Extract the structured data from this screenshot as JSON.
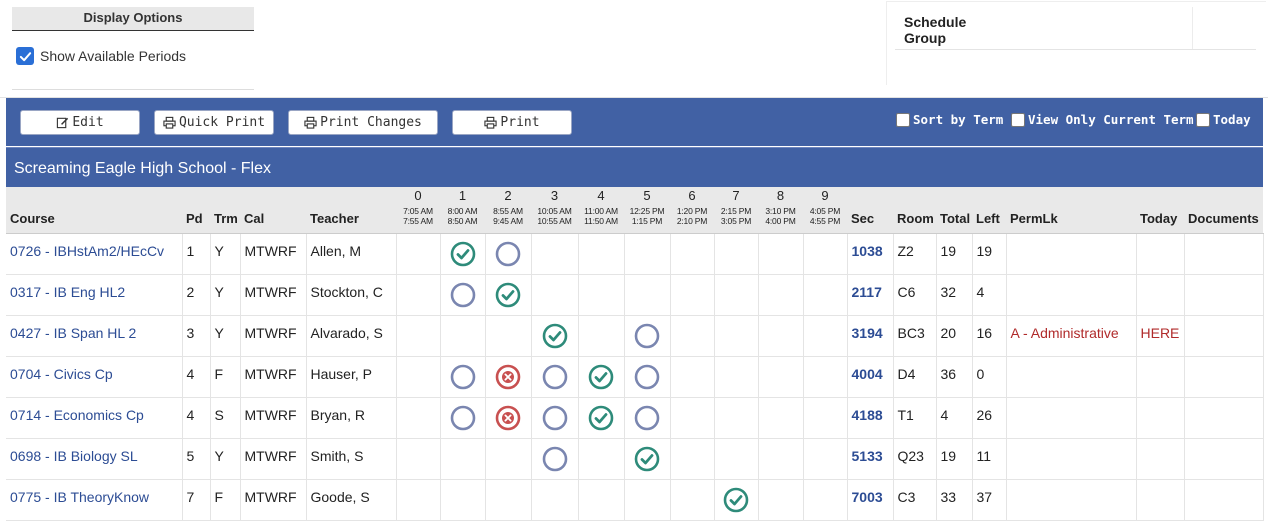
{
  "display_options": {
    "header": "Display Options",
    "show_available_periods": "Show Available Periods"
  },
  "schedule_group": {
    "label": "Schedule Group"
  },
  "toolbar": {
    "edit": "Edit",
    "quick_print": "Quick Print",
    "print_changes": "Print Changes",
    "print": "Print",
    "sort_by_term": "Sort by Term",
    "view_only_current_term": "View Only Current Term",
    "today": "Today"
  },
  "school_title": "Screaming Eagle High School - Flex",
  "columns": {
    "course": "Course",
    "pd": "Pd",
    "trm": "Trm",
    "cal": "Cal",
    "teacher": "Teacher",
    "sec": "Sec",
    "room": "Room",
    "total": "Total",
    "left": "Left",
    "permlk": "PermLk",
    "today": "Today",
    "documents": "Documents"
  },
  "periods": [
    {
      "num": "0",
      "start": "7:05 AM",
      "end": "7:55 AM"
    },
    {
      "num": "1",
      "start": "8:00 AM",
      "end": "8:50 AM"
    },
    {
      "num": "2",
      "start": "8:55 AM",
      "end": "9:45 AM"
    },
    {
      "num": "3",
      "start": "10:05 AM",
      "end": "10:55 AM"
    },
    {
      "num": "4",
      "start": "11:00 AM",
      "end": "11:50 AM"
    },
    {
      "num": "5",
      "start": "12:25 PM",
      "end": "1:15 PM"
    },
    {
      "num": "6",
      "start": "1:20 PM",
      "end": "2:10 PM"
    },
    {
      "num": "7",
      "start": "2:15 PM",
      "end": "3:05 PM"
    },
    {
      "num": "8",
      "start": "3:10 PM",
      "end": "4:00 PM"
    },
    {
      "num": "9",
      "start": "4:05 PM",
      "end": "4:55 PM"
    }
  ],
  "rows": [
    {
      "course": "0726 - IBHstAm2/HEcCv",
      "pd": "1",
      "trm": "Y",
      "cal": "MTWRF",
      "teacher": "Allen, M",
      "slots": [
        "",
        "check",
        "open",
        "",
        "",
        "",
        "",
        "",
        "",
        ""
      ],
      "sec": "1038",
      "room": "Z2",
      "total": "19",
      "left": "19",
      "permlk": "",
      "today": "",
      "documents": ""
    },
    {
      "course": "0317 - IB Eng HL2",
      "pd": "2",
      "trm": "Y",
      "cal": "MTWRF",
      "teacher": "Stockton, C",
      "slots": [
        "",
        "open",
        "check",
        "",
        "",
        "",
        "",
        "",
        "",
        ""
      ],
      "sec": "2117",
      "room": "C6",
      "total": "32",
      "left": "4",
      "permlk": "",
      "today": "",
      "documents": ""
    },
    {
      "course": "0427 - IB Span HL 2",
      "pd": "3",
      "trm": "Y",
      "cal": "MTWRF",
      "teacher": "Alvarado, S",
      "slots": [
        "",
        "",
        "",
        "check",
        "",
        "open",
        "",
        "",
        "",
        ""
      ],
      "sec": "3194",
      "room": "BC3",
      "total": "20",
      "left": "16",
      "permlk": "A - Administrative",
      "today": "HERE",
      "documents": ""
    },
    {
      "course": "0704 - Civics Cp",
      "pd": "4",
      "trm": "F",
      "cal": "MTWRF",
      "teacher": "Hauser, P",
      "slots": [
        "",
        "open",
        "x",
        "open",
        "check",
        "open",
        "",
        "",
        "",
        ""
      ],
      "sec": "4004",
      "room": "D4",
      "total": "36",
      "left": "0",
      "permlk": "",
      "today": "",
      "documents": ""
    },
    {
      "course": "0714 - Economics Cp",
      "pd": "4",
      "trm": "S",
      "cal": "MTWRF",
      "teacher": "Bryan, R",
      "slots": [
        "",
        "open",
        "x",
        "open",
        "check",
        "open",
        "",
        "",
        "",
        ""
      ],
      "sec": "4188",
      "room": "T1",
      "total": "4",
      "left": "26",
      "permlk": "",
      "today": "",
      "documents": ""
    },
    {
      "course": "0698 - IB Biology SL",
      "pd": "5",
      "trm": "Y",
      "cal": "MTWRF",
      "teacher": "Smith, S",
      "slots": [
        "",
        "",
        "",
        "open",
        "",
        "check",
        "",
        "",
        "",
        ""
      ],
      "sec": "5133",
      "room": "Q23",
      "total": "19",
      "left": "11",
      "permlk": "",
      "today": "",
      "documents": ""
    },
    {
      "course": "0775 - IB TheoryKnow",
      "pd": "7",
      "trm": "F",
      "cal": "MTWRF",
      "teacher": "Goode, S",
      "slots": [
        "",
        "",
        "",
        "",
        "",
        "",
        "",
        "check",
        "",
        ""
      ],
      "sec": "7003",
      "room": "C3",
      "total": "33",
      "left": "37",
      "permlk": "",
      "today": "",
      "documents": ""
    }
  ],
  "colors": {
    "header_blue": "#4161a4",
    "link_blue": "#2c4c94",
    "check_green": "#2e8b7a",
    "open_slate": "#7a86b0",
    "x_red": "#c85050"
  }
}
